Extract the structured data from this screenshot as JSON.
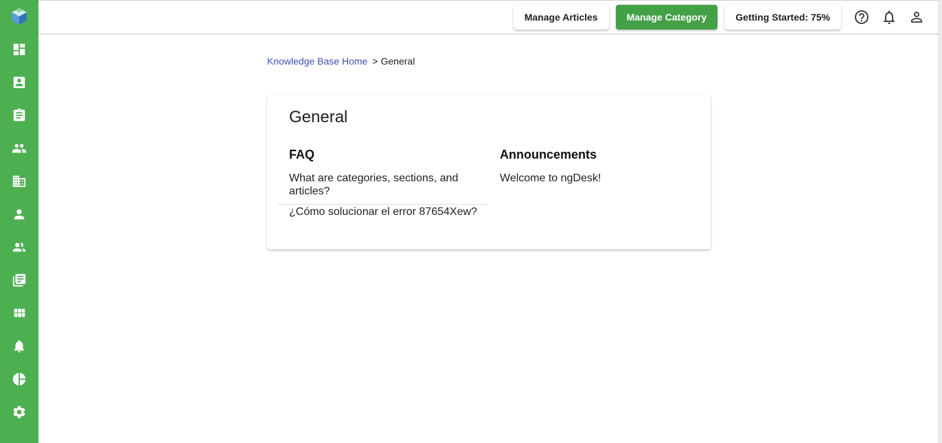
{
  "sidebar": {
    "items": [
      {
        "name": "logo-icon"
      },
      {
        "name": "dashboard-icon"
      },
      {
        "name": "contact-card-icon"
      },
      {
        "name": "clipboard-icon"
      },
      {
        "name": "people-icon"
      },
      {
        "name": "building-icon"
      },
      {
        "name": "person-icon"
      },
      {
        "name": "group-icon"
      },
      {
        "name": "library-books-icon"
      },
      {
        "name": "apps-grid-icon"
      },
      {
        "name": "bell-icon"
      },
      {
        "name": "pie-chart-icon"
      },
      {
        "name": "settings-icon"
      }
    ],
    "color": "#4caf50"
  },
  "topbar": {
    "manage_articles": "Manage Articles",
    "manage_category": "Manage Category",
    "getting_started": "Getting Started: 75%",
    "icons": [
      "help-icon",
      "notifications-icon",
      "account-icon"
    ],
    "primary_color": "#43a047"
  },
  "breadcrumb": {
    "home": "Knowledge Base Home",
    "separator": ">",
    "current": "General"
  },
  "category": {
    "title": "General",
    "sections": [
      {
        "title": "FAQ",
        "articles": [
          "What are categories, sections, and articles?",
          "¿Cómo solucionar el error 87654Xew?"
        ]
      },
      {
        "title": "Announcements",
        "articles": [
          "Welcome to ngDesk!"
        ]
      }
    ]
  }
}
